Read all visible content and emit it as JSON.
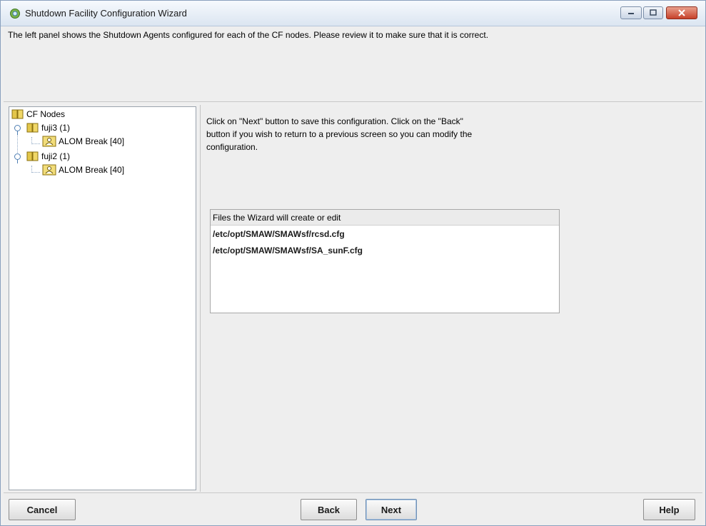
{
  "window": {
    "title": "Shutdown Facility Configuration Wizard"
  },
  "description": "The left panel shows the Shutdown Agents configured for each of the CF nodes. Please review it to make sure that it is correct.",
  "tree": {
    "root": "CF Nodes",
    "nodes": [
      {
        "label": "fuji3 (1)",
        "agent": "ALOM Break [40]"
      },
      {
        "label": "fuji2 (1)",
        "agent": "ALOM Break [40]"
      }
    ]
  },
  "info": {
    "line1": "Click on \"Next\" button to save this configuration. Click on the \"Back\"",
    "line2": "button if you wish to return to a previous screen so you can modify the",
    "line3": "configuration."
  },
  "files": {
    "header": "Files the Wizard will create or edit",
    "items": [
      "/etc/opt/SMAW/SMAWsf/rcsd.cfg",
      "/etc/opt/SMAW/SMAWsf/SA_sunF.cfg"
    ]
  },
  "buttons": {
    "cancel": "Cancel",
    "back": "Back",
    "next": "Next",
    "help": "Help"
  },
  "icons": {
    "app": "wizard-app-icon",
    "folder": "node-folder-icon",
    "agent": "shutdown-agent-icon"
  },
  "colors": {
    "titlebar": "#dbe5f1",
    "panel_bg": "#eeeeee",
    "close_button": "#c7412a"
  }
}
